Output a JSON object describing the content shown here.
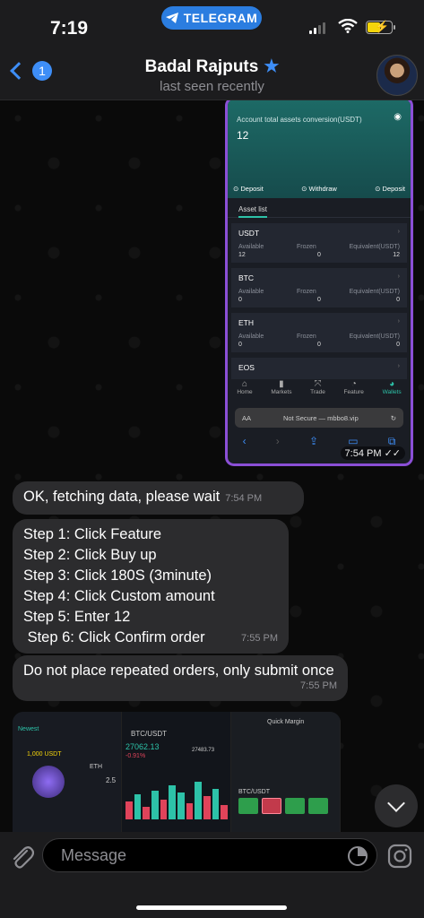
{
  "status_bar": {
    "time": "7:19",
    "app_pill": "TELEGRAM"
  },
  "header": {
    "back_count": "1",
    "name": "Badal Rajputs",
    "status": "last seen recently"
  },
  "screenshot": {
    "account_label": "Account total assets conversion(USDT)",
    "account_value": "12",
    "actions": [
      "Deposit",
      "Withdraw",
      "Deposit"
    ],
    "asset_list_title": "Asset list",
    "columns": [
      "Available",
      "Frozen",
      "Equivalent(USDT)"
    ],
    "assets": [
      {
        "name": "USDT",
        "available": "12",
        "frozen": "0",
        "equivalent": "12"
      },
      {
        "name": "BTC",
        "available": "0",
        "frozen": "0",
        "equivalent": "0"
      },
      {
        "name": "ETH",
        "available": "0",
        "frozen": "0",
        "equivalent": "0"
      },
      {
        "name": "EOS",
        "available": "",
        "frozen": "",
        "equivalent": ""
      }
    ],
    "tabs": [
      "Home",
      "Markets",
      "Trade",
      "Feature",
      "Wallets"
    ],
    "url_prefix": "AA",
    "url": "Not Secure — mbbo8.vip",
    "time": "7:54 PM"
  },
  "messages": [
    {
      "text": "OK, fetching data, please wait",
      "time": "7:54 PM"
    },
    {
      "lines": [
        "Step 1: Click Feature",
        "Step 2: Click Buy up",
        "Step 3: Click 180S (3minute)",
        "Step 4: Click Custom amount",
        "Step 5: Enter 12",
        " Step 6: Click Confirm order"
      ],
      "time": "7:55 PM"
    },
    {
      "text": "Do not place repeated orders, only submit once",
      "time": "7:55 PM"
    }
  ],
  "bottom_image": {
    "p1_line1": "Newest",
    "p1_line2": "1,000 USDT",
    "p1_coin": "ETH",
    "p1_value": "2.5",
    "p2_pair": "BTC/USDT",
    "p2_price": "27062.13",
    "p2_change": "-0.91%",
    "p2_high": "27483.73",
    "p3_title": "Quick Margin",
    "p3_pair": "BTC/USDT"
  },
  "input": {
    "placeholder": "Message"
  }
}
